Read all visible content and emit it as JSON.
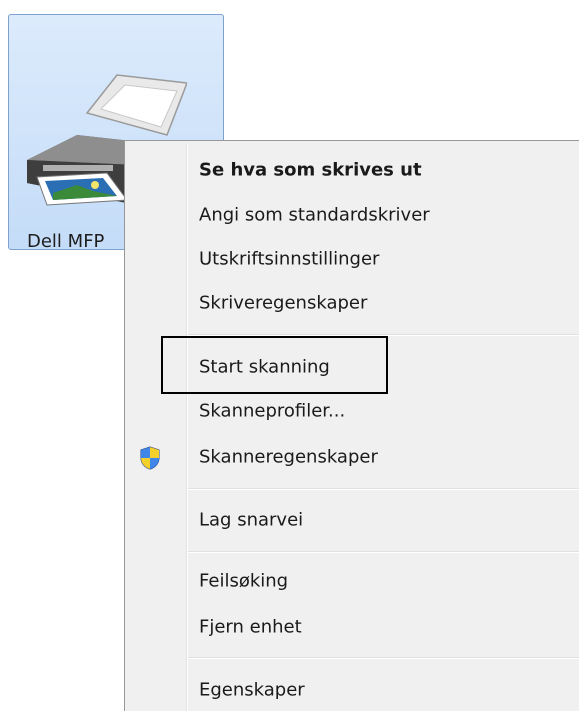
{
  "device": {
    "label": "Dell MFP",
    "icon": "printer-icon"
  },
  "context_menu": {
    "groups": [
      [
        {
          "label": "Se hva som skrives ut",
          "bold": true
        },
        {
          "label": "Angi som standardskriver"
        },
        {
          "label": "Utskriftsinnstillinger"
        },
        {
          "label": "Skriveregenskaper"
        }
      ],
      [
        {
          "label": "Start skanning",
          "highlighted": true
        },
        {
          "label": "Skanneprofiler..."
        },
        {
          "label": "Skanneregenskaper",
          "icon": "uac-shield-icon"
        }
      ],
      [
        {
          "label": "Lag snarvei"
        }
      ],
      [
        {
          "label": "Feilsøking"
        },
        {
          "label": "Fjern enhet"
        }
      ],
      [
        {
          "label": "Egenskaper"
        }
      ]
    ]
  },
  "colors": {
    "selection_fill": "#c4dcf8",
    "selection_border": "#7da2ce",
    "menu_background": "#f0f0f0",
    "highlight_frame": "#000000"
  }
}
